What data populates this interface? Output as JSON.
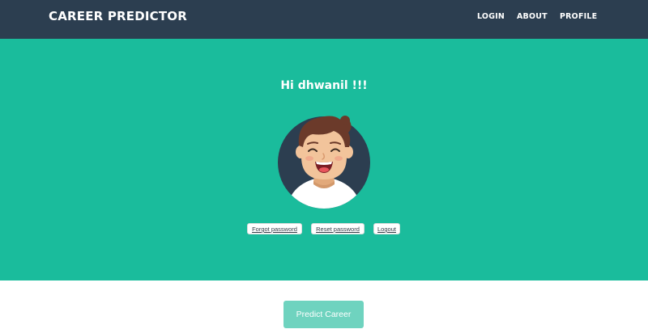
{
  "navbar": {
    "brand": "CAREER PREDICTOR",
    "links": [
      "LOGIN",
      "ABOUT",
      "PROFILE"
    ]
  },
  "masthead": {
    "greeting": "Hi dhwanil !!!",
    "avatar_icon": "cartoon-boy-avatar-icon"
  },
  "account_actions": [
    "Forgot password",
    "Reset password",
    "Logout"
  ],
  "predict": {
    "label": "Predict Career"
  },
  "colors": {
    "navbar_bg": "#2c3e50",
    "masthead_bg": "#1abc9c",
    "predict_button_bg": "#6fd3bf",
    "avatar_circle": "#2c3e50"
  }
}
